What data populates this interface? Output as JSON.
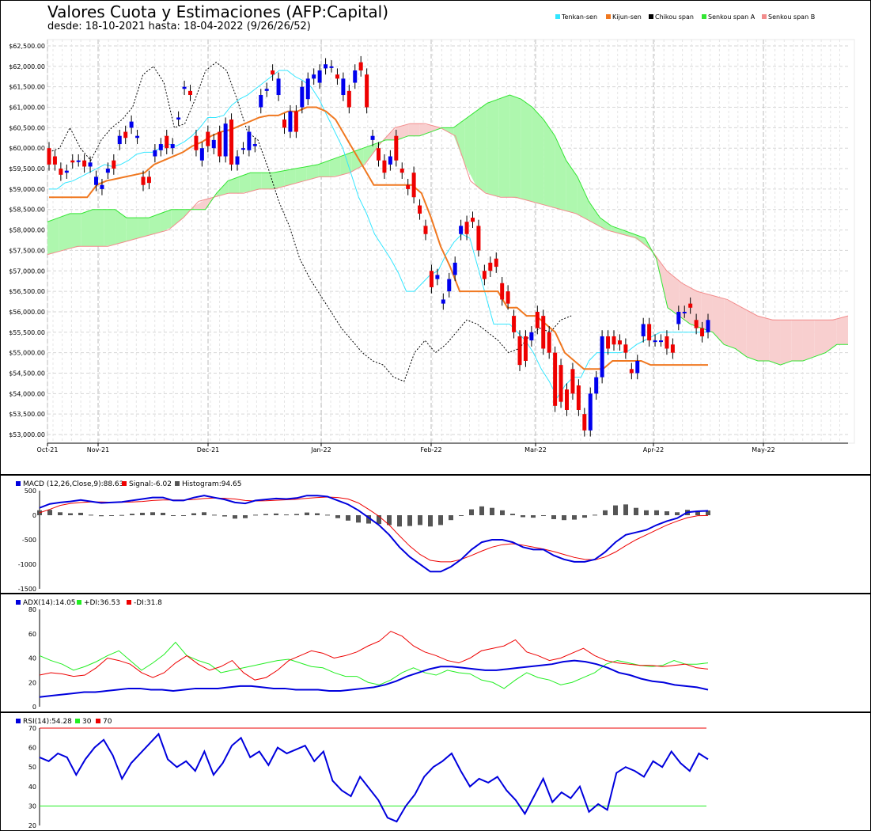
{
  "title": "Valores Cuota y Estimaciones (AFP:Capital)",
  "subtitle": "desde: 18-10-2021 hasta: 18-04-2022 (9/26/26/52)",
  "legend": [
    {
      "label": "Tenkan-sen",
      "color": "#33e6ff"
    },
    {
      "label": "Kijun-sen",
      "color": "#f07820"
    },
    {
      "label": "Chikou span",
      "color": "#000000"
    },
    {
      "label": "Senkou span A",
      "color": "#33e633"
    },
    {
      "label": "Senkou span B",
      "color": "#f28c8c"
    }
  ],
  "chart_data": [
    {
      "type": "candlestick",
      "name": "ichimoku",
      "ylim": [
        53000,
        62500
      ],
      "y_ticks": [
        "$53,000.00",
        "$53,500.00",
        "$54,000.00",
        "$54,500.00",
        "$55,000.00",
        "$55,500.00",
        "$56,000.00",
        "$56,500.00",
        "$57,000.00",
        "$57,500.00",
        "$58,000.00",
        "$58,500.00",
        "$59,000.00",
        "$59,500.00",
        "$60,000.00",
        "$60,500.00",
        "$61,000.00",
        "$61,500.00",
        "$62,000.00",
        "$62,500.00"
      ],
      "x_ticks": [
        "Oct-21",
        "Nov-21",
        "Dec-21",
        "Jan-22",
        "Feb-22",
        "Mar-22",
        "Apr-22",
        "May-22"
      ],
      "candles": [
        [
          60000,
          59600
        ],
        [
          59800,
          59600
        ],
        [
          59500,
          59350
        ],
        [
          59400,
          59450
        ],
        [
          59700,
          59650
        ],
        [
          59700,
          59700
        ],
        [
          59700,
          59550
        ],
        [
          59550,
          59650
        ],
        [
          59100,
          59300
        ],
        [
          59000,
          59100
        ],
        [
          59400,
          59500
        ],
        [
          59700,
          59500
        ],
        [
          60100,
          60300
        ],
        [
          60400,
          60250
        ],
        [
          60500,
          60650
        ],
        [
          60250,
          60300
        ],
        [
          59300,
          59100
        ],
        [
          59300,
          59150
        ],
        [
          59800,
          59950
        ],
        [
          59950,
          60100
        ],
        [
          60300,
          60000
        ],
        [
          60000,
          60100
        ],
        [
          60700,
          60750
        ],
        [
          61450,
          61500
        ],
        [
          61400,
          61300
        ],
        [
          60300,
          59950
        ],
        [
          59700,
          60000
        ],
        [
          60400,
          60050
        ],
        [
          60000,
          60200
        ],
        [
          60400,
          59800
        ],
        [
          59800,
          60600
        ],
        [
          60700,
          59600
        ],
        [
          59600,
          59800
        ],
        [
          60000,
          60000
        ],
        [
          59950,
          60400
        ],
        [
          60050,
          60100
        ],
        [
          61000,
          61300
        ],
        [
          61400,
          61450
        ],
        [
          61900,
          61800
        ],
        [
          61300,
          61700
        ],
        [
          60700,
          60500
        ],
        [
          60400,
          60900
        ],
        [
          60900,
          60400
        ],
        [
          61000,
          61500
        ],
        [
          61200,
          61700
        ],
        [
          61700,
          61800
        ],
        [
          61600,
          61900
        ],
        [
          61950,
          62050
        ],
        [
          62000,
          62000
        ],
        [
          61800,
          61700
        ],
        [
          61300,
          61700
        ],
        [
          61400,
          61000
        ],
        [
          61600,
          61900
        ],
        [
          62100,
          61900
        ],
        [
          61800,
          61000
        ],
        [
          60200,
          60300
        ],
        [
          60000,
          59700
        ],
        [
          59700,
          59400
        ],
        [
          59600,
          59800
        ],
        [
          60300,
          59700
        ],
        [
          59500,
          59400
        ],
        [
          59100,
          59000
        ],
        [
          59400,
          58800
        ],
        [
          58600,
          58400
        ],
        [
          58100,
          57900
        ],
        [
          57000,
          56600
        ],
        [
          56800,
          56900
        ],
        [
          56200,
          56300
        ],
        [
          56500,
          56800
        ],
        [
          56900,
          57200
        ],
        [
          57900,
          58100
        ],
        [
          58200,
          57900
        ],
        [
          58300,
          58200
        ],
        [
          58100,
          57500
        ],
        [
          57000,
          56800
        ],
        [
          57200,
          57000
        ],
        [
          57300,
          57100
        ],
        [
          56700,
          56300
        ],
        [
          56500,
          56200
        ],
        [
          55900,
          55500
        ],
        [
          55400,
          54700
        ],
        [
          55400,
          54800
        ],
        [
          55300,
          55500
        ],
        [
          56000,
          55600
        ],
        [
          55900,
          55100
        ],
        [
          55500,
          55000
        ],
        [
          55000,
          53700
        ],
        [
          54700,
          53800
        ],
        [
          54100,
          53600
        ],
        [
          54600,
          54000
        ],
        [
          54200,
          53600
        ],
        [
          53500,
          53100
        ],
        [
          53100,
          54000
        ],
        [
          54000,
          54400
        ],
        [
          54400,
          55400
        ],
        [
          55400,
          55100
        ],
        [
          55400,
          55200
        ],
        [
          55300,
          55200
        ],
        [
          55200,
          55000
        ],
        [
          54600,
          54500
        ],
        [
          54500,
          54800
        ],
        [
          55400,
          55700
        ],
        [
          55700,
          55300
        ],
        [
          55300,
          55300
        ],
        [
          55300,
          55300
        ],
        [
          55400,
          55100
        ],
        [
          55200,
          55000
        ],
        [
          55700,
          56000
        ],
        [
          56000,
          56000
        ],
        [
          56200,
          56100
        ],
        [
          55800,
          55600
        ],
        [
          55600,
          55400
        ],
        [
          55500,
          55800
        ]
      ],
      "tenkan": [
        59000,
        59000,
        59150,
        59200,
        59300,
        59400,
        59500,
        59600,
        59550,
        59600,
        59700,
        59850,
        59900,
        59900,
        60000,
        60100,
        60050,
        60150,
        60300,
        60500,
        60750,
        60750,
        60800,
        61050,
        61200,
        61300,
        61450,
        61600,
        61750,
        61900,
        61900,
        61750,
        61650,
        61500,
        61200,
        60800,
        60400,
        60000,
        59400,
        58800,
        58400,
        57900,
        57600,
        57300,
        56950,
        56500,
        56500,
        56700,
        56900,
        57000,
        57400,
        57700,
        57900,
        57800,
        57100,
        56400,
        55700,
        55700,
        55700,
        55500,
        55300,
        55000,
        54600,
        54300,
        53900,
        54200,
        54400,
        54400,
        54800,
        55000,
        55000,
        55000,
        55000,
        55050,
        55200,
        55300,
        55400,
        55500,
        55500,
        55500,
        55500,
        55500,
        55500,
        55500
      ],
      "kijun": [
        58800,
        58800,
        58800,
        58800,
        58800,
        59100,
        59200,
        59250,
        59300,
        59350,
        59400,
        59600,
        59700,
        59800,
        59900,
        60050,
        60150,
        60300,
        60400,
        60450,
        60550,
        60650,
        60750,
        60800,
        60800,
        60900,
        60900,
        61000,
        61000,
        60900,
        60700,
        60300,
        59900,
        59500,
        59100,
        59100,
        59100,
        59100,
        59100,
        58900,
        58300,
        57600,
        57100,
        56500,
        56500,
        56500,
        56500,
        56500,
        56100,
        56100,
        55900,
        55900,
        55700,
        55500,
        55000,
        54800,
        54600,
        54600,
        54600,
        54800,
        54800,
        54800,
        54800,
        54700,
        54700,
        54700,
        54700,
        54700,
        54700,
        54700
      ],
      "senkou_a": [
        58200,
        58300,
        58400,
        58400,
        58500,
        58500,
        58500,
        58300,
        58300,
        58300,
        58400,
        58500,
        58500,
        58500,
        58500,
        58900,
        59200,
        59300,
        59400,
        59400,
        59400,
        59450,
        59500,
        59550,
        59600,
        59700,
        59800,
        59900,
        60000,
        60100,
        60200,
        60200,
        60300,
        60300,
        60400,
        60500,
        60500,
        60700,
        60900,
        61100,
        61200,
        61300,
        61200,
        61000,
        60700,
        60300,
        59700,
        59300,
        58700,
        58300,
        58100,
        58000,
        57900,
        57800,
        57300,
        56100,
        55900,
        55700,
        55600,
        55500,
        55200,
        55100,
        54900,
        54800,
        54800,
        54700,
        54800,
        54800,
        54900,
        55000,
        55200,
        55200
      ],
      "senkou_b": [
        57400,
        57500,
        57600,
        57600,
        57600,
        57700,
        57800,
        57900,
        58000,
        58300,
        58700,
        58800,
        58900,
        58900,
        59000,
        59000,
        59100,
        59200,
        59300,
        59300,
        59400,
        59600,
        60100,
        60500,
        60600,
        60600,
        60500,
        60300,
        59200,
        58900,
        58800,
        58800,
        58700,
        58600,
        58500,
        58400,
        58200,
        58000,
        57900,
        57800,
        57500,
        57000,
        56700,
        56500,
        56400,
        56300,
        56100,
        55900,
        55800,
        55800,
        55800,
        55800,
        55800,
        55900
      ],
      "chikou": [
        59900,
        60000,
        60500,
        60000,
        59700,
        60200,
        60500,
        60700,
        61000,
        61800,
        62000,
        61600,
        60500,
        60600,
        61200,
        61900,
        62100,
        61900,
        61200,
        60400,
        60200,
        59500,
        58700,
        58100,
        57300,
        56800,
        56400,
        56000,
        55600,
        55300,
        55000,
        54800,
        54700,
        54400,
        54300,
        55000,
        55300,
        55000,
        55200,
        55500,
        55800,
        55700,
        55500,
        55300,
        55000,
        55100,
        55400,
        55600,
        55500,
        55800,
        55900
      ]
    },
    {
      "type": "macd",
      "name": "MACD",
      "label": "MACD (12,26,Close,9):88.63",
      "signal_label": "Signal:-6.02",
      "hist_label": "Histogram:94.65",
      "ylim": [
        -1500,
        500
      ],
      "y_ticks": [
        "500",
        "0",
        "-500",
        "-1000",
        "-1500"
      ],
      "macd": [
        150,
        230,
        260,
        280,
        310,
        280,
        250,
        260,
        270,
        300,
        330,
        360,
        360,
        300,
        300,
        360,
        400,
        360,
        320,
        260,
        240,
        300,
        320,
        340,
        330,
        350,
        400,
        400,
        380,
        300,
        220,
        100,
        -50,
        -200,
        -400,
        -650,
        -850,
        -1000,
        -1150,
        -1150,
        -1050,
        -900,
        -700,
        -550,
        -500,
        -500,
        -550,
        -650,
        -700,
        -700,
        -820,
        -900,
        -950,
        -950,
        -900,
        -750,
        -550,
        -400,
        -350,
        -300,
        -200,
        -120,
        -60,
        60,
        80,
        90
      ],
      "signal": [
        50,
        120,
        200,
        240,
        260,
        270,
        270,
        265,
        265,
        270,
        280,
        300,
        310,
        310,
        310,
        320,
        340,
        350,
        345,
        330,
        300,
        290,
        295,
        305,
        315,
        325,
        345,
        360,
        370,
        360,
        330,
        250,
        120,
        -20,
        -200,
        -420,
        -630,
        -800,
        -920,
        -950,
        -950,
        -900,
        -820,
        -730,
        -650,
        -600,
        -580,
        -610,
        -650,
        -690,
        -740,
        -800,
        -860,
        -900,
        -910,
        -850,
        -750,
        -620,
        -500,
        -400,
        -300,
        -200,
        -120,
        -50,
        -10,
        -6
      ]
    },
    {
      "type": "line",
      "name": "ADX",
      "label": "ADX(14):14.05",
      "plus_label": "+DI:36.53",
      "minus_label": "-DI:31.8",
      "ylim": [
        0,
        80
      ],
      "y_ticks": [
        "80",
        "60",
        "40",
        "20",
        "0"
      ],
      "adx": [
        8,
        9,
        10,
        11,
        12,
        12,
        13,
        14,
        15,
        15,
        14,
        14,
        13,
        14,
        15,
        15,
        15,
        16,
        17,
        17,
        16,
        15,
        15,
        14,
        14,
        14,
        13,
        13,
        14,
        15,
        16,
        18,
        21,
        25,
        28,
        31,
        33,
        33,
        32,
        31,
        30,
        30,
        31,
        32,
        33,
        34,
        35,
        37,
        38,
        37,
        35,
        32,
        28,
        26,
        23,
        21,
        20,
        18,
        17,
        16,
        14
      ],
      "plus_di": [
        42,
        38,
        35,
        30,
        33,
        37,
        42,
        46,
        38,
        30,
        36,
        43,
        53,
        42,
        38,
        35,
        28,
        30,
        32,
        34,
        36,
        38,
        39,
        36,
        33,
        32,
        28,
        25,
        25,
        20,
        18,
        22,
        28,
        32,
        28,
        26,
        30,
        28,
        27,
        22,
        20,
        15,
        22,
        28,
        24,
        22,
        18,
        20,
        24,
        28,
        35,
        38,
        36,
        34,
        33,
        34,
        38,
        35,
        35,
        36
      ],
      "minus_di": [
        26,
        28,
        27,
        25,
        26,
        32,
        40,
        38,
        35,
        28,
        24,
        28,
        36,
        42,
        35,
        30,
        33,
        38,
        28,
        22,
        24,
        30,
        38,
        42,
        46,
        44,
        40,
        42,
        45,
        50,
        54,
        62,
        58,
        50,
        45,
        42,
        38,
        36,
        40,
        46,
        48,
        50,
        55,
        45,
        42,
        38,
        40,
        44,
        48,
        42,
        38,
        36,
        35,
        34,
        34,
        33,
        34,
        35,
        32,
        31
      ]
    },
    {
      "type": "line",
      "name": "RSI",
      "label": "RSI(14):54.28",
      "low_label": "30",
      "high_label": "70",
      "ylim": [
        20,
        70
      ],
      "y_ticks": [
        "70",
        "60",
        "50",
        "40",
        "30",
        "20"
      ],
      "rsi": [
        55,
        53,
        57,
        55,
        46,
        54,
        60,
        64,
        56,
        44,
        52,
        57,
        62,
        67,
        54,
        50,
        53,
        48,
        58,
        46,
        52,
        61,
        65,
        55,
        58,
        51,
        60,
        57,
        59,
        61,
        53,
        58,
        43,
        38,
        35,
        45,
        39,
        33,
        24,
        22,
        30,
        36,
        45,
        50,
        53,
        57,
        48,
        40,
        44,
        42,
        45,
        38,
        33,
        26,
        35,
        44,
        32,
        37,
        34,
        40,
        27,
        31,
        28,
        47,
        50,
        48,
        45,
        53,
        50,
        58,
        52,
        48,
        57,
        54
      ]
    }
  ]
}
